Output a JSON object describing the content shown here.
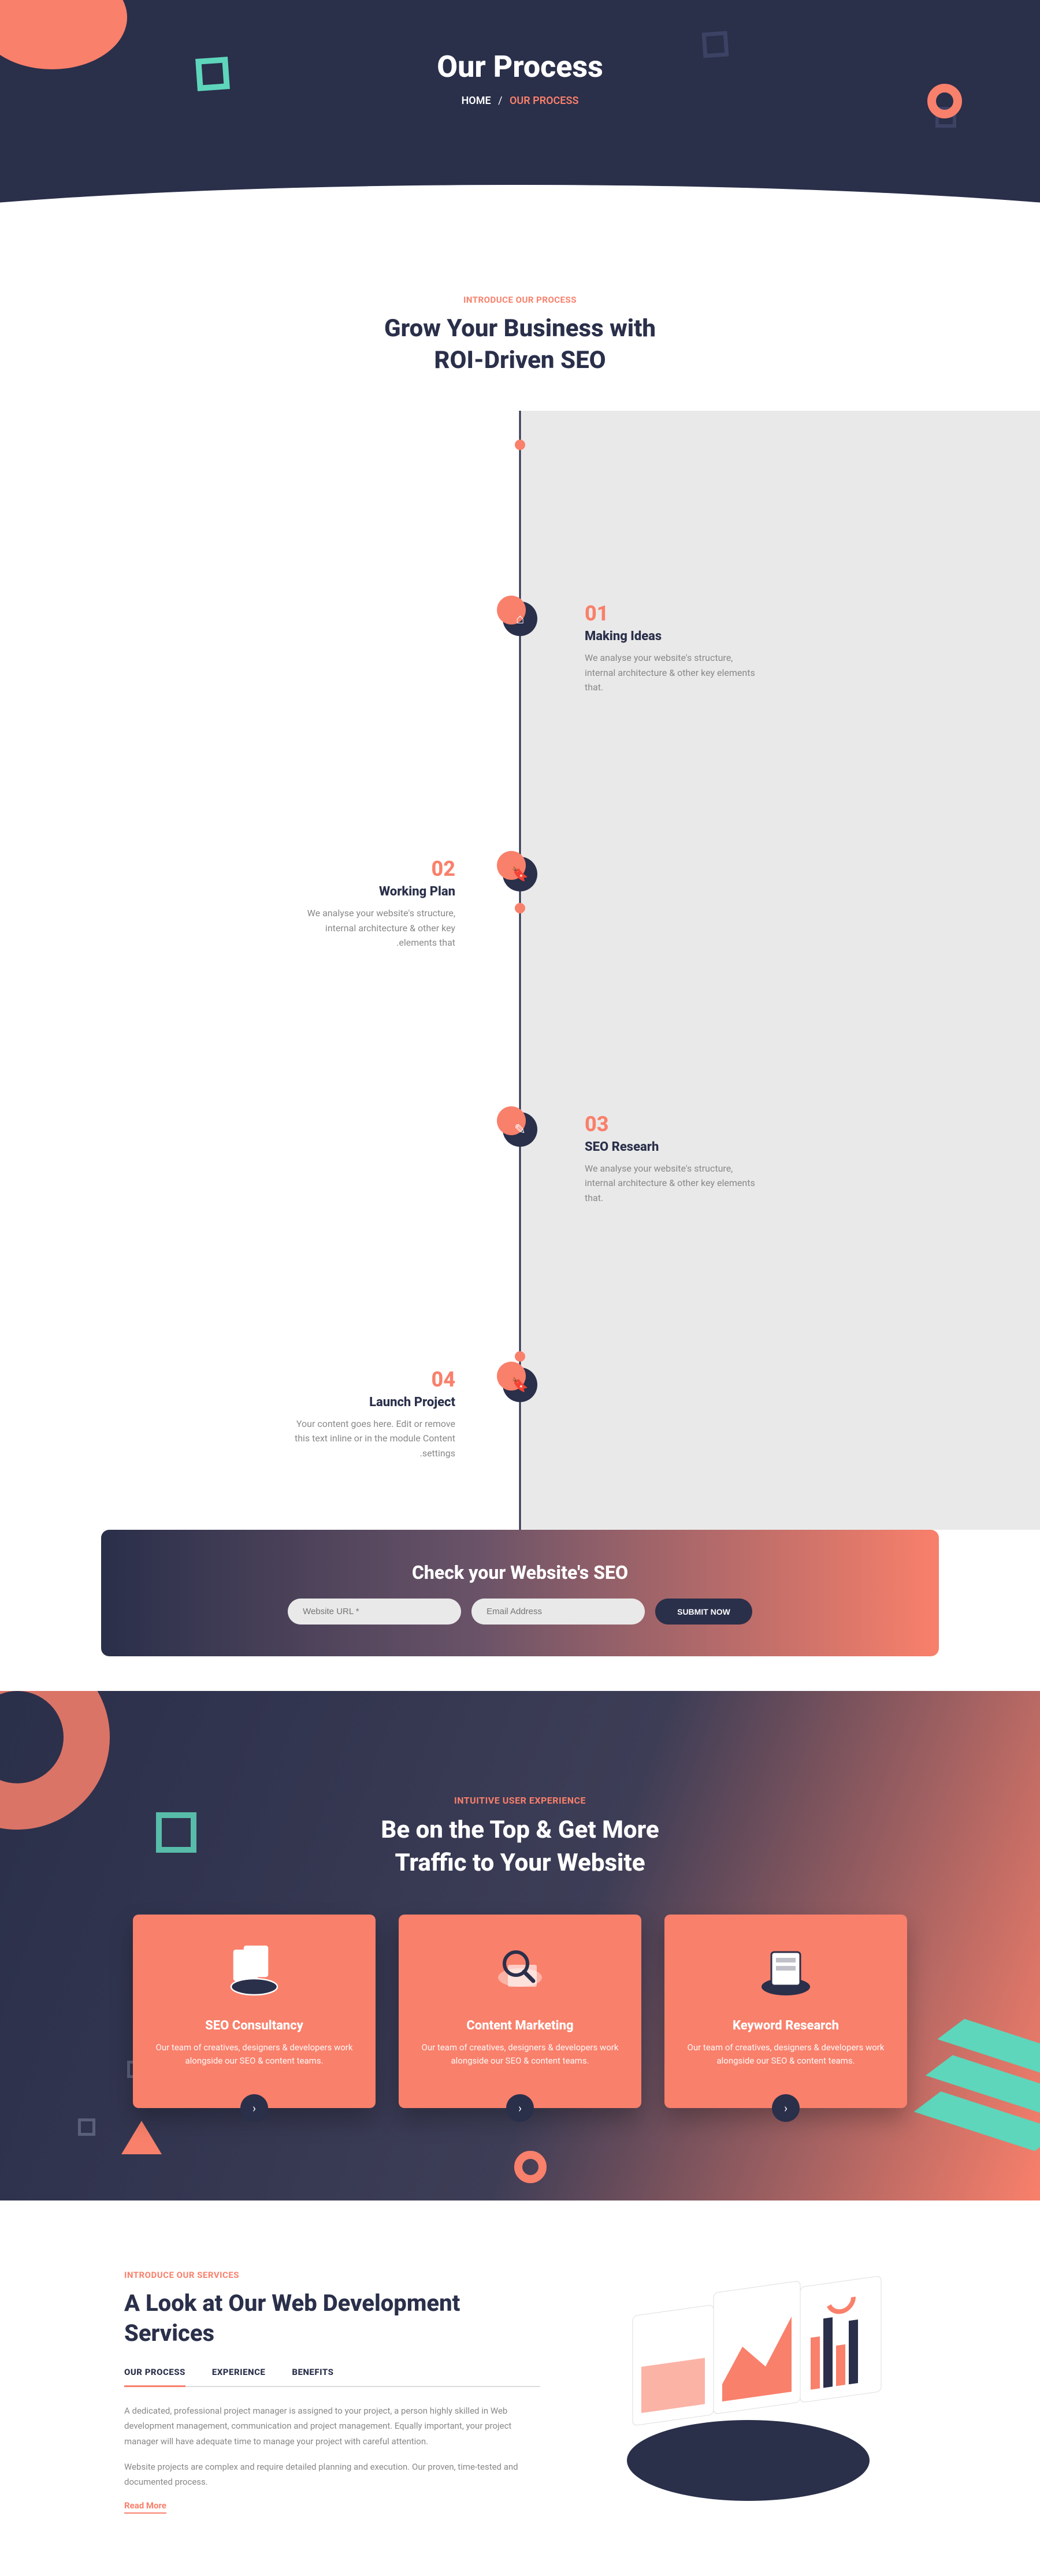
{
  "hero": {
    "title": "Our Process",
    "home": "HOME",
    "current": "OUR PROCESS"
  },
  "intro": {
    "eyebrow": "INTRODUCE OUR PROCESS",
    "h1": "Grow Your Business with",
    "h2": "ROI-Driven SEO"
  },
  "steps": [
    {
      "num": "01",
      "title": "Making Ideas",
      "desc": "We analyse your website's structure, internal architecture & other key elements that."
    },
    {
      "num": "02",
      "title": "Working Plan",
      "desc": "We analyse your website's structure, internal architecture & other key .elements that"
    },
    {
      "num": "03",
      "title": "SEO Researh",
      "desc": "We analyse your website's structure, internal architecture & other key elements that."
    },
    {
      "num": "04",
      "title": "Launch Project",
      "desc": "Your content goes here. Edit or remove this text inline or in the module Content .settings"
    }
  ],
  "cta": {
    "heading": "Check your Website's SEO",
    "urlPh": "Website URL *",
    "emailPh": "Email Address",
    "btn": "SUBMIT NOW"
  },
  "traffic": {
    "eyebrow": "Intuitive User Experience",
    "l1": "Be on the Top & Get More",
    "l2": "Traffic to Your Website"
  },
  "cards": [
    {
      "title": "SEO Consultancy",
      "desc": "Our team of creatives, designers & developers work alongside our SEO & content teams."
    },
    {
      "title": "Content Marketing",
      "desc": "Our team of creatives, designers & developers work alongside our SEO & content teams."
    },
    {
      "title": "Keyword Research",
      "desc": "Our team of creatives, designers & developers work alongside our SEO & content teams."
    }
  ],
  "services": {
    "eyebrow": "INTRODUCE OUR SERVICES",
    "heading": "A Look at Our Web Development Services",
    "tabs": [
      "OUR PROCESS",
      "EXPERIENCE",
      "BENEFITS"
    ],
    "p1": "A dedicated, professional project manager is assigned to your project, a person highly skilled in Web development management, communication and project management. Equally important, your project manager will have adequate time to manage your project with careful attention.",
    "p2": "Website projects are complex and require detailed planning and execution. Our proven, time-tested and documented process.",
    "readmore": "Read More"
  }
}
